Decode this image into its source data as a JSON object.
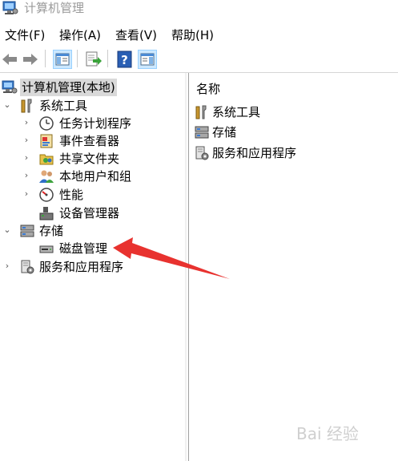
{
  "window": {
    "title": "计算机管理"
  },
  "menu": [
    "文件(F)",
    "操作(A)",
    "查看(V)",
    "帮助(H)"
  ],
  "toolbar": {
    "buttons": [
      "back-arrow-icon",
      "forward-arrow-icon",
      "show-hide-tree-icon",
      "export-list-icon",
      "help-icon",
      "show-hide-action-pane-icon"
    ]
  },
  "tree": {
    "root": "计算机管理(本地)",
    "system_tools": "系统工具",
    "task_scheduler": "任务计划程序",
    "event_viewer": "事件查看器",
    "shared_folders": "共享文件夹",
    "local_users": "本地用户和组",
    "performance": "性能",
    "device_manager": "设备管理器",
    "storage": "存储",
    "disk_management": "磁盘管理",
    "services_apps": "服务和应用程序"
  },
  "list": {
    "column_name": "名称",
    "items": [
      "系统工具",
      "存储",
      "服务和应用程序"
    ]
  },
  "annotation": {
    "color": "#e8322f"
  },
  "watermark": "Bai 经验"
}
